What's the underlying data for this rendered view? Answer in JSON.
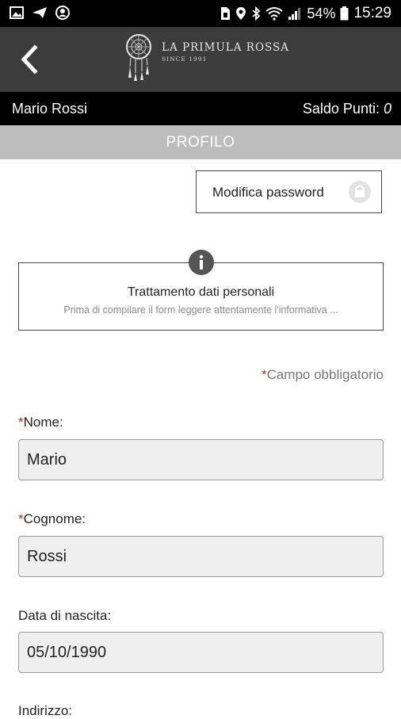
{
  "status_bar": {
    "battery": "54%",
    "time": "15:29"
  },
  "header": {
    "logo_title": "LA PRIMULA ROSSA",
    "logo_subtitle": "SINCE 1991"
  },
  "user_bar": {
    "name": "Mario Rossi",
    "points_label": "Saldo Punti:",
    "points_value": "0"
  },
  "section_title": "PROFILO",
  "password_button": {
    "label": "Modifica password"
  },
  "info_box": {
    "title": "Trattamento dati personali",
    "subtitle": "Prima di compilare il form leggere attentamente l'informativa ..."
  },
  "required_note": {
    "asterisk": "*",
    "text": "Campo obbligatorio"
  },
  "fields": [
    {
      "label": "Nome:",
      "required": "*",
      "value": "Mario"
    },
    {
      "label": "Cognome:",
      "required": "*",
      "value": "Rossi"
    },
    {
      "label": "Data di nascita:",
      "required": "",
      "value": "05/10/1990"
    },
    {
      "label": "Indirizzo:",
      "required": "",
      "value": ""
    }
  ],
  "colors": {
    "header_bg": "#3c3c3c",
    "section_bg": "#bdbdbd",
    "required_red": "#c62828",
    "input_bg": "#efefef"
  }
}
